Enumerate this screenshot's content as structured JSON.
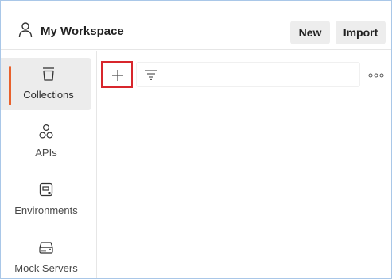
{
  "header": {
    "workspace_icon": "user-icon",
    "workspace_title": "My Workspace",
    "new_label": "New",
    "import_label": "Import"
  },
  "sidebar": {
    "items": [
      {
        "label": "Collections",
        "icon": "trash-can-icon",
        "active": true
      },
      {
        "label": "APIs",
        "icon": "api-nodes-icon",
        "active": false
      },
      {
        "label": "Environments",
        "icon": "environment-icon",
        "active": false
      },
      {
        "label": "Mock Servers",
        "icon": "server-icon",
        "active": false
      }
    ]
  },
  "toolbar": {
    "add_icon": "plus-icon",
    "filter_icon": "filter-icon",
    "more_icon": "more-horizontal-icon"
  },
  "colors": {
    "accent": "#e8612c",
    "highlight_border": "#d8262c",
    "active_bg": "#ececec"
  }
}
